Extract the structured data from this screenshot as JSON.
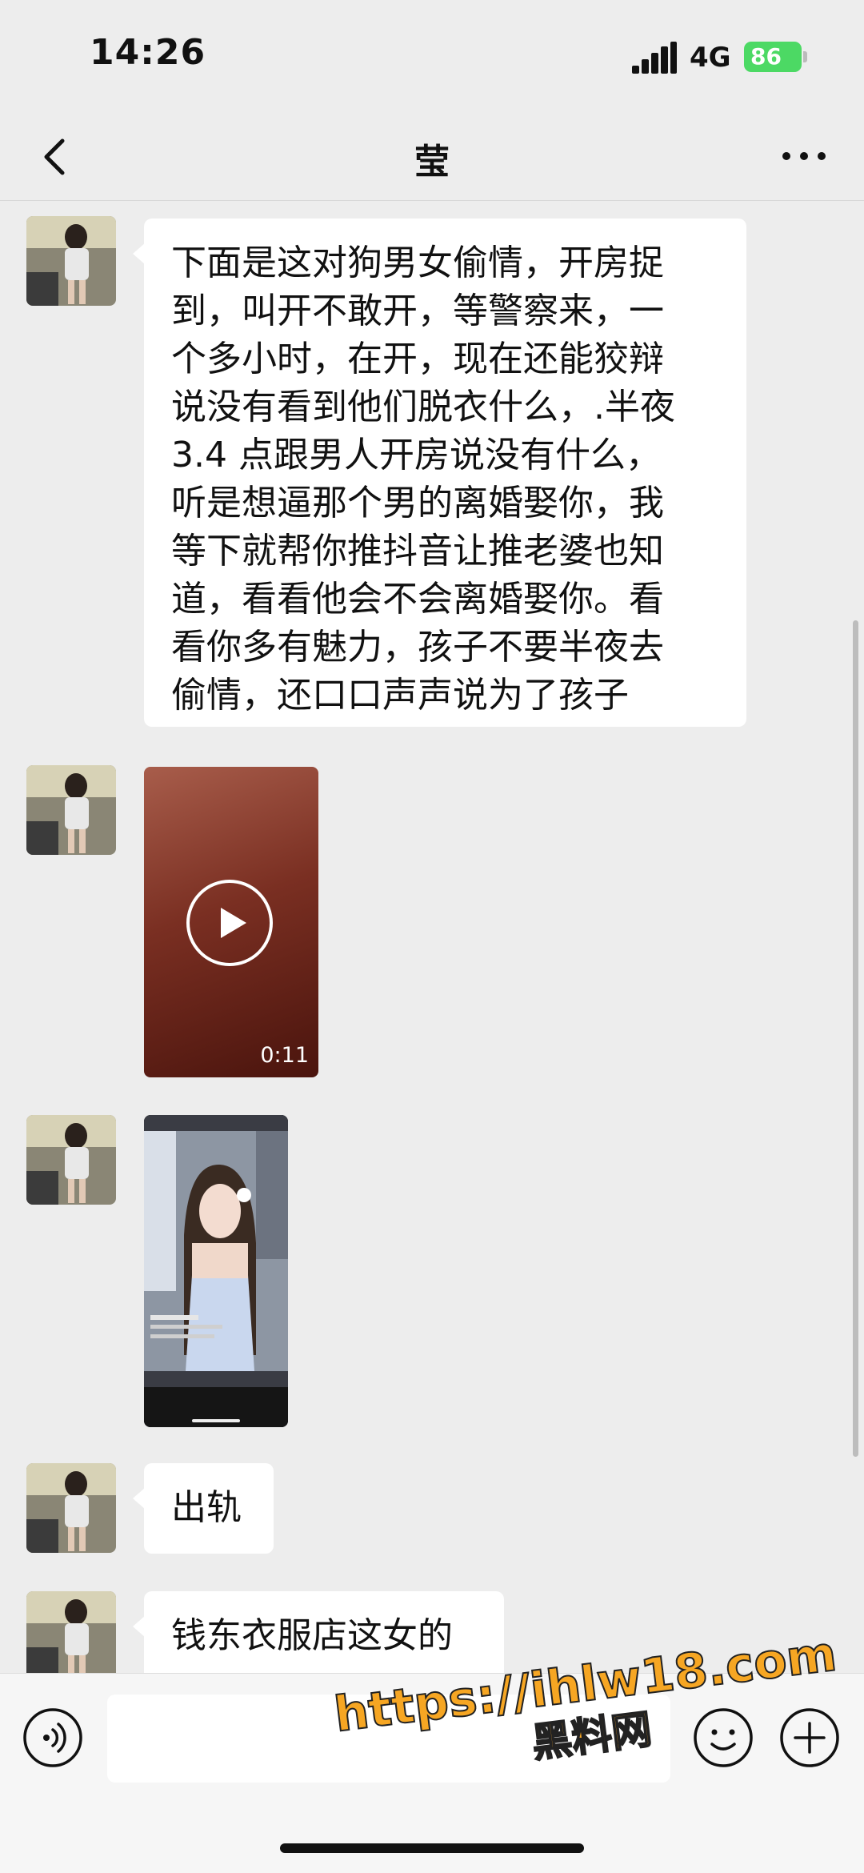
{
  "status_bar": {
    "time": "14:26",
    "network": "4G",
    "battery": "86"
  },
  "header": {
    "title": "莹"
  },
  "messages": [
    {
      "type": "text",
      "lines": [
        "下面是这对狗男女偷情，开房捉",
        "到，叫开不敢开，等警察来，一",
        "个多小时，在开，现在还能狡辩",
        "说没有看到他们脱衣什么，.半夜",
        "3.4 点跟男人开房说没有什么，",
        "听是想逼那个男的离婚娶你，我",
        "等下就帮你推抖音让推老婆也知",
        "道，看看他会不会离婚娶你。看",
        "看你多有魅力，孩子不要半夜去",
        "偷情，还口口声声说为了孩子"
      ]
    },
    {
      "type": "video",
      "duration": "0:11"
    },
    {
      "type": "image"
    },
    {
      "type": "text",
      "lines": [
        "出轨"
      ]
    },
    {
      "type": "text",
      "lines": [
        "钱东衣服店这女的"
      ]
    }
  ],
  "input_bar": {
    "value": "",
    "placeholder": ""
  },
  "watermark": {
    "url": "https://ihlw18.com",
    "name": "黑料网"
  },
  "icons": {
    "back": "chevron-left-icon",
    "more": "more-dots-icon",
    "voice": "voice-icon",
    "emoji": "emoji-icon",
    "plus": "plus-icon",
    "play": "play-icon"
  }
}
